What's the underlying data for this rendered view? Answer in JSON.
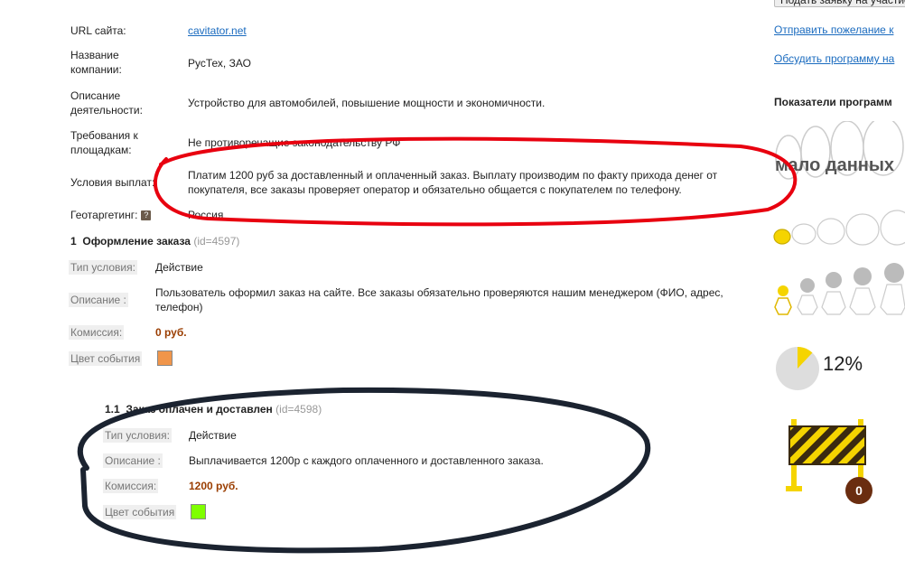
{
  "top_button": "Подать заявку на участие",
  "info": {
    "url_label": "URL сайта:",
    "url_value": "cavitator.net",
    "company_label": "Название компании:",
    "company_value": "РусТех, ЗАО",
    "desc_label": "Описание деятельности:",
    "desc_value": "Устройство для автомобилей, повышение мощности и экономичности.",
    "req_label": "Требования к площадкам:",
    "req_value": "Не противоречащие законодательству РФ",
    "payout_label": "Условия выплат:",
    "payout_value": "Платим 1200 руб за доставленный и оплаченный заказ. Выплату производим по факту прихода денег от покупателя, все заказы проверяет оператор и обязательно общается с покупателем по телефону.",
    "geo_label": "Геотаргетинг:",
    "geo_help": "?",
    "geo_value": "Россия"
  },
  "conditions": [
    {
      "number": "1",
      "title": "Оформление заказа",
      "id_tag": "(id=4597)",
      "type_label": "Тип условия:",
      "type_value": "Действие",
      "desc_label": "Описание :",
      "desc_value": "Пользователь оформил заказ на сайте. Все заказы обязательно проверяются нашим менеджером (ФИО, адрес, телефон)",
      "commission_label": "Комиссия:",
      "commission_value": "0 руб.",
      "color_label": "Цвет события",
      "color": "#f0954a"
    },
    {
      "number": "1.1",
      "title": "Заказ оплачен и доставлен",
      "id_tag": "(id=4598)",
      "type_label": "Тип условия:",
      "type_value": "Действие",
      "desc_label": "Описание :",
      "desc_value": "Выплачивается 1200р с каждого оплаченного и доставленного заказа.",
      "commission_label": "Комиссия:",
      "commission_value": "1200 руб.",
      "color_label": "Цвет события",
      "color": "#7fff00"
    }
  ],
  "sidebar": {
    "link_wish": "Отправить пожелание к",
    "link_discuss": "Обсудить программу на",
    "stats_title": "Показатели программ",
    "low_data": "мало данных",
    "percent": "12%",
    "percent_fraction": 0.12,
    "counter": "0"
  },
  "colors": {
    "link": "#1a6bbf",
    "commission": "#9a3d00",
    "accent_yellow": "#f5d400",
    "annotation_red": "#e8000f",
    "annotation_dark": "#1b2330"
  }
}
